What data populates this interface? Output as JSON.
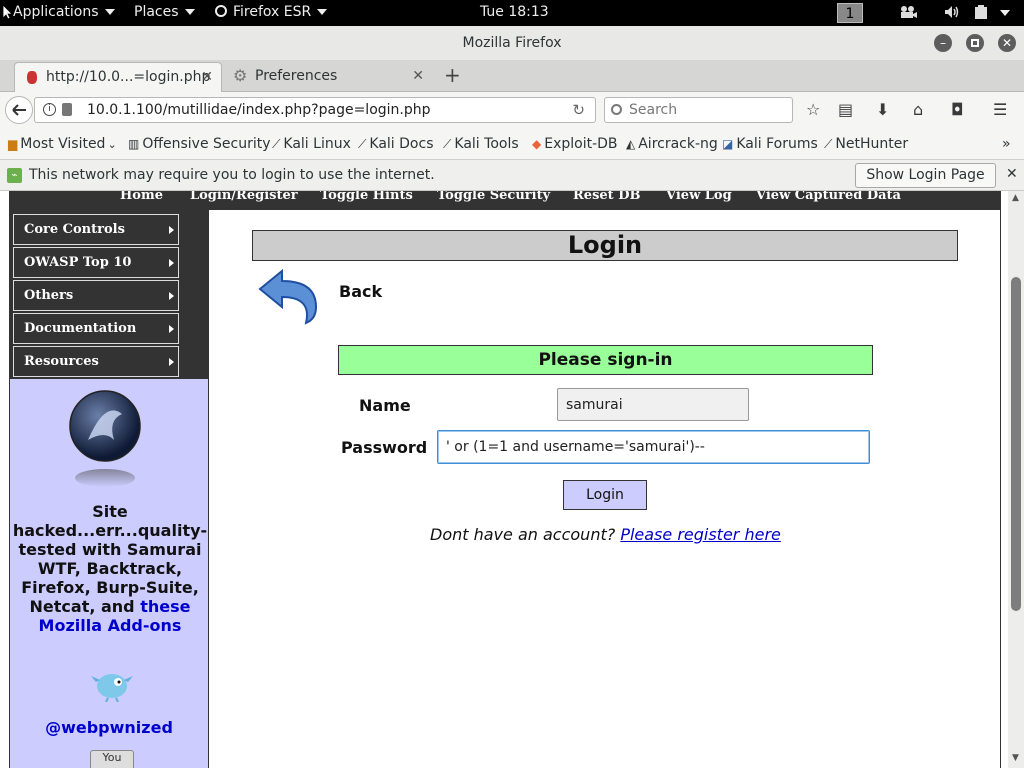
{
  "topbar": {
    "applications": "Applications",
    "places": "Places",
    "browser": "Firefox ESR",
    "clock": "Tue 18:13",
    "workspace": "1"
  },
  "window": {
    "title": "Mozilla Firefox"
  },
  "tabs": [
    {
      "label": "http://10.0...=login.php",
      "active": true
    },
    {
      "label": "Preferences",
      "active": false
    }
  ],
  "navbar": {
    "url": "10.0.1.100/mutillidae/index.php?page=login.php",
    "search_placeholder": "Search"
  },
  "bookmarks": [
    {
      "label": "Most Visited",
      "icon": "folder-icon"
    },
    {
      "label": "Offensive Security",
      "icon": "offsec-icon"
    },
    {
      "label": "Kali Linux",
      "icon": "kali-icon"
    },
    {
      "label": "Kali Docs",
      "icon": "kali-icon"
    },
    {
      "label": "Kali Tools",
      "icon": "kali-icon"
    },
    {
      "label": "Exploit-DB",
      "icon": "exploitdb-icon"
    },
    {
      "label": "Aircrack-ng",
      "icon": "aircrack-icon"
    },
    {
      "label": "Kali Forums",
      "icon": "kali-forums-icon"
    },
    {
      "label": "NetHunter",
      "icon": "kali-icon"
    }
  ],
  "notification": {
    "message": "This network may require you to login to use the internet.",
    "button": "Show Login Page"
  },
  "site_menu": [
    "Home",
    "Login/Register",
    "Toggle Hints",
    "Toggle Security",
    "Reset DB",
    "View Log",
    "View Captured Data"
  ],
  "sidebar": {
    "items": [
      "Core Controls",
      "OWASP Top 10",
      "Others",
      "Documentation",
      "Resources"
    ],
    "site_text": "Site hacked...err...quality-tested with Samurai WTF, Backtrack, Firefox, Burp-Suite, Netcat, and",
    "site_link": "these Mozilla Add-ons",
    "twitter_handle": "@webpwnized",
    "youtube_label": "You"
  },
  "login": {
    "heading": "Login",
    "back": "Back",
    "signin": "Please sign-in",
    "name_label": "Name",
    "name_value": "samurai",
    "password_label": "Password",
    "password_value": "' or (1=1 and username='samurai')-- ",
    "button": "Login",
    "no_account": "Dont have an account?",
    "register_link": "Please register here"
  },
  "colors": {
    "signin_bg": "#99ff99",
    "sidebar_bg": "#ccccff",
    "menu_bg": "#333333",
    "link": "#0000cc"
  }
}
